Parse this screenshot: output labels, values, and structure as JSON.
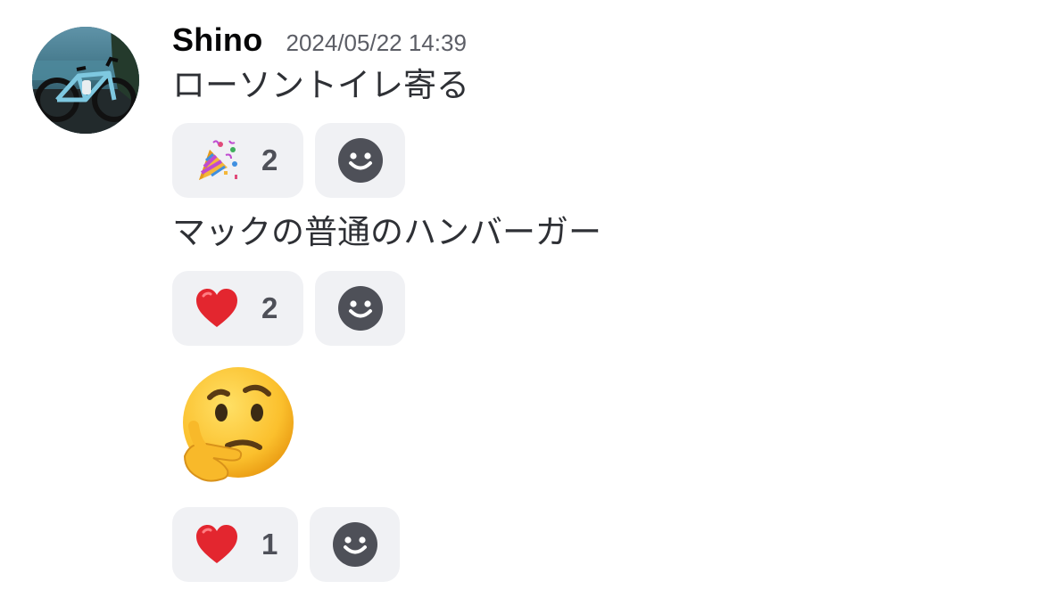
{
  "author": {
    "name": "Shino",
    "avatar_icon": "bicycle-photo-avatar"
  },
  "timestamp": "2024/05/22 14:39",
  "messages": [
    {
      "text": "ローソントイレ寄る",
      "reactions": [
        {
          "emoji_icon": "party-popper-emoji",
          "count": "2"
        }
      ]
    },
    {
      "text": "マックの普通のハンバーガー",
      "reactions": [
        {
          "emoji_icon": "red-heart-emoji",
          "count": "2"
        }
      ]
    },
    {
      "emoji_only": "thinking-face-emoji",
      "reactions": [
        {
          "emoji_icon": "red-heart-emoji",
          "count": "1"
        }
      ]
    }
  ],
  "add_reaction_icon": "smiley-face-icon",
  "colors": {
    "reaction_bg": "#f0f1f4",
    "count_text": "#4e5058",
    "timestamp_text": "#5c5e66",
    "icon_fill": "#4e5058",
    "heart": "#e3262f"
  }
}
